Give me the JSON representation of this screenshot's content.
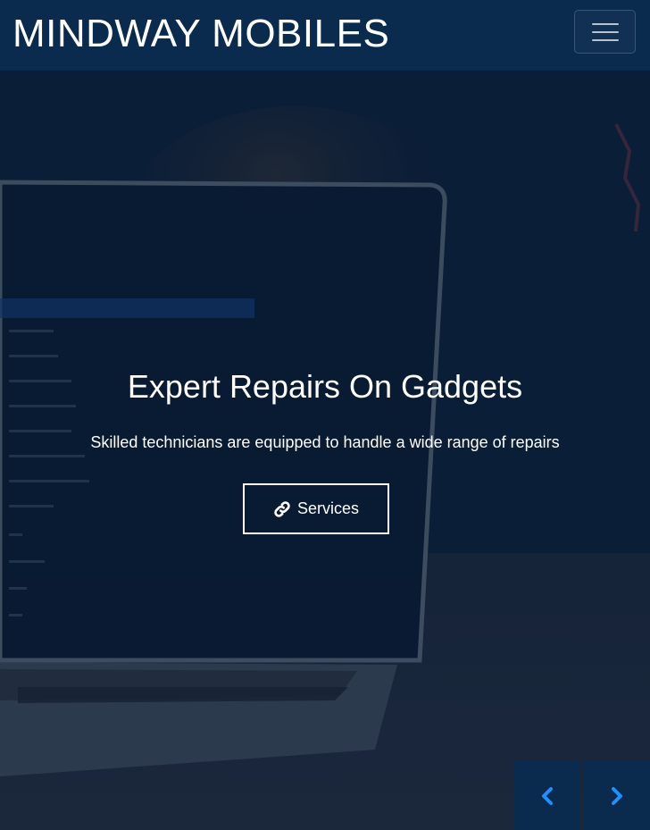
{
  "navbar": {
    "brand": "MINDWAY MOBILES",
    "toggler_icon": "hamburger-menu-icon"
  },
  "hero": {
    "headline": "Expert Repairs On Gadgets",
    "subline": "Skilled technicians are equipped to handle a wide range of repairs",
    "button_label": "Services",
    "button_icon": "link-icon"
  },
  "carousel": {
    "prev_icon": "chevron-left-icon",
    "next_icon": "chevron-right-icon"
  },
  "colors": {
    "navbar": "#0a2a4e",
    "hero_overlay": "#081c3a",
    "control_arrow": "#1e90ff",
    "text": "#ffffff"
  }
}
